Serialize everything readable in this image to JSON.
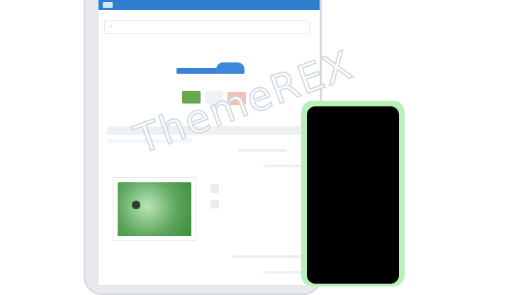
{
  "watermark": {
    "text": "ThemeREX"
  },
  "colors": {
    "appbar": "#2f7fcf",
    "phone_frame": "#b8f1b8",
    "phone_screen": "#000000"
  },
  "icons": {
    "logo": "logo-icon",
    "phone": "phone-icon"
  }
}
